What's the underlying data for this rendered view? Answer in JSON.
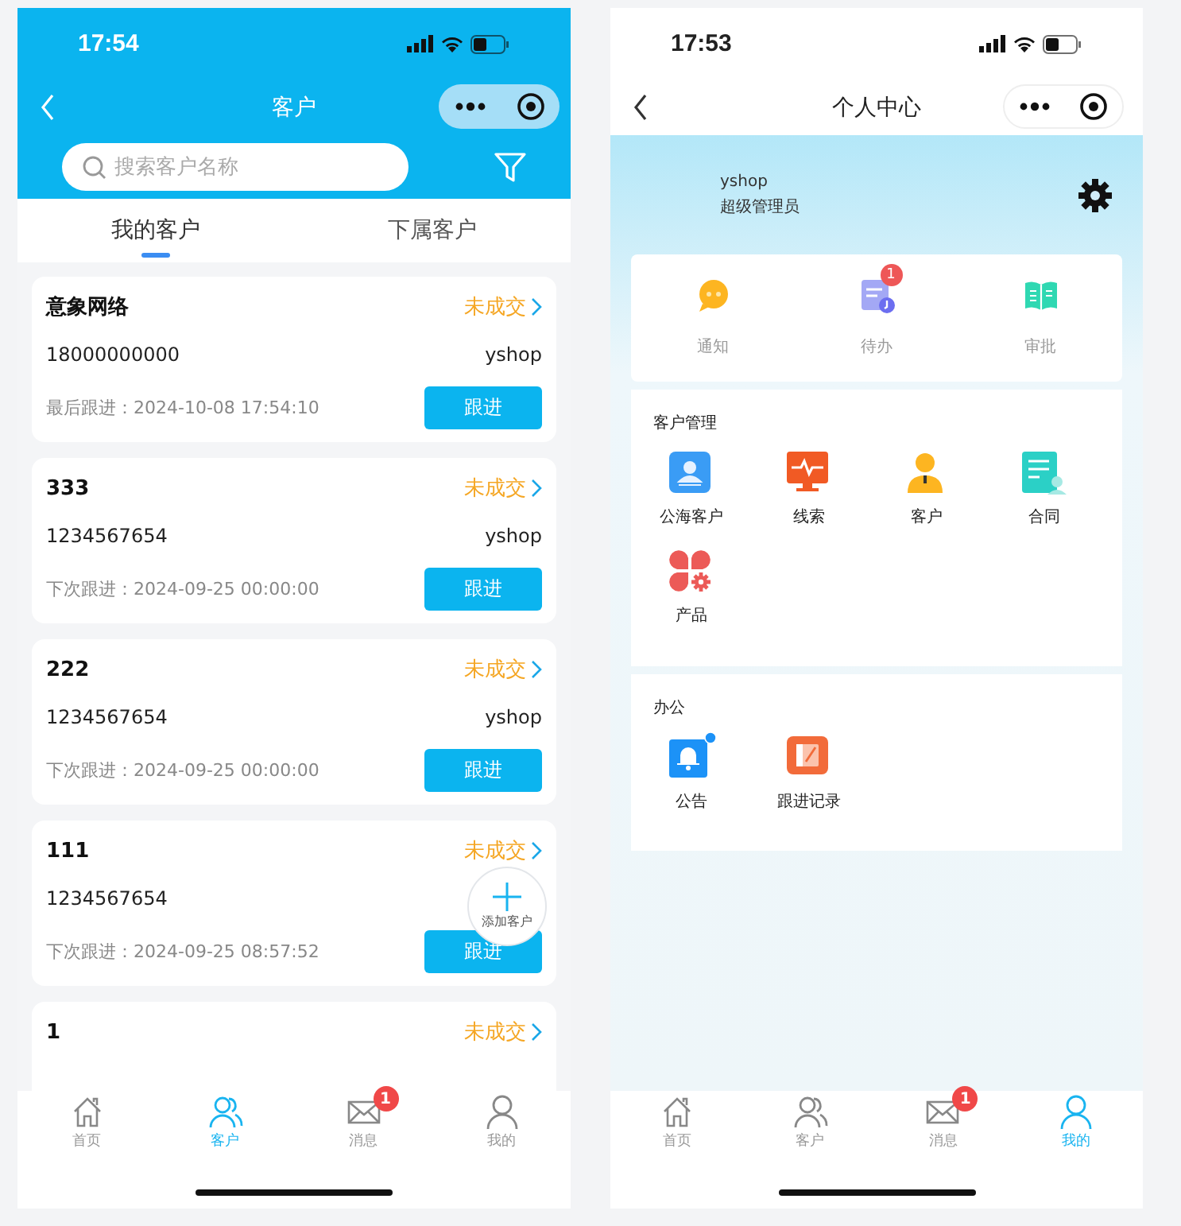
{
  "customer_screen": {
    "status_bar": {
      "time": "17:54"
    },
    "nav": {
      "title": "客户"
    },
    "search": {
      "placeholder": "搜索客户名称"
    },
    "tabs": [
      {
        "label": "我的客户",
        "selected": true
      },
      {
        "label": "下属客户",
        "selected": false
      }
    ],
    "customers": [
      {
        "name": "意象网络",
        "status": "未成交",
        "phone": "18000000000",
        "owner": "yshop",
        "followup": "最后跟进：2024-10-08 17:54:10",
        "action": "跟进"
      },
      {
        "name": "333",
        "status": "未成交",
        "phone": "1234567654",
        "owner": "yshop",
        "followup": "下次跟进：2024-09-25 00:00:00",
        "action": "跟进"
      },
      {
        "name": "222",
        "status": "未成交",
        "phone": "1234567654",
        "owner": "yshop",
        "followup": "下次跟进：2024-09-25 00:00:00",
        "action": "跟进"
      },
      {
        "name": "111",
        "status": "未成交",
        "phone": "1234567654",
        "followup": "下次跟进：2024-09-25 08:57:52",
        "action": "跟进"
      },
      {
        "name": "1",
        "status": "未成交"
      }
    ],
    "add_button": {
      "label": "添加客户"
    },
    "tab_bar": [
      {
        "label": "首页",
        "selected": false
      },
      {
        "label": "客户",
        "selected": true
      },
      {
        "label": "消息",
        "selected": false,
        "badge": "1"
      },
      {
        "label": "我的",
        "selected": false
      }
    ]
  },
  "profile_screen": {
    "status_bar": {
      "time": "17:53"
    },
    "nav": {
      "title": "个人中心"
    },
    "user": {
      "name": "yshop",
      "role": "超级管理员"
    },
    "quick_actions": [
      {
        "label": "通知"
      },
      {
        "label": "待办",
        "badge": "1"
      },
      {
        "label": "审批"
      }
    ],
    "sections": [
      {
        "title": "客户管理",
        "items": [
          {
            "label": "公海客户"
          },
          {
            "label": "线索"
          },
          {
            "label": "客户"
          },
          {
            "label": "合同"
          },
          {
            "label": "产品"
          }
        ]
      },
      {
        "title": "办公",
        "items": [
          {
            "label": "公告",
            "dot": true
          },
          {
            "label": "跟进记录",
            "dot": false
          }
        ]
      }
    ],
    "tab_bar": [
      {
        "label": "首页",
        "selected": false
      },
      {
        "label": "客户",
        "selected": false
      },
      {
        "label": "消息",
        "selected": false,
        "badge": "1"
      },
      {
        "label": "我的",
        "selected": true
      }
    ]
  }
}
